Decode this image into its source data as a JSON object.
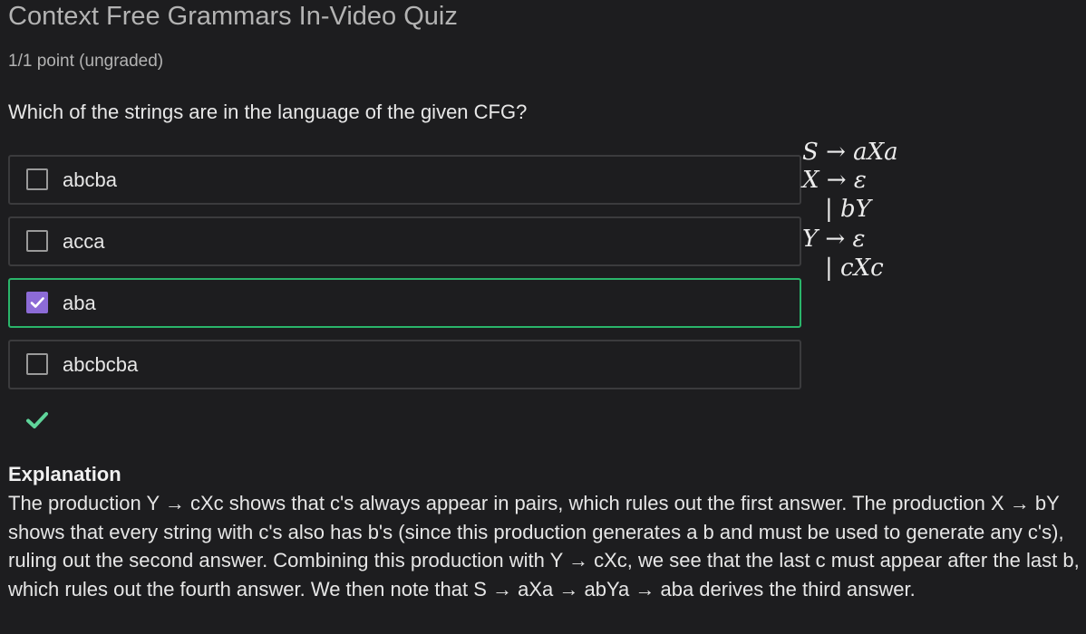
{
  "quiz": {
    "title": "Context Free Grammars In-Video Quiz",
    "score": "1/1 point (ungraded)",
    "question": "Which of the strings are in the language of the given CFG?"
  },
  "options": [
    {
      "label": "abcba",
      "checked": false,
      "selected": false
    },
    {
      "label": "acca",
      "checked": false,
      "selected": false
    },
    {
      "label": "aba",
      "checked": true,
      "selected": true
    },
    {
      "label": "abcbcba",
      "checked": false,
      "selected": false
    }
  ],
  "grammar": {
    "rules": [
      "S → aXa",
      "X → ε",
      "| bY",
      "Y → ε",
      "| cXc"
    ]
  },
  "result": {
    "icon": "checkmark-icon",
    "status": "correct"
  },
  "explanation": {
    "heading": "Explanation",
    "text": "The production Y → cXc shows that c's always appear in pairs, which rules out the first answer. The production X → bY shows that every string with c's also has b's (since this production generates a b and must be used to generate any c's), ruling out the second answer. Combining this production with Y → cXc, we see that the last c must appear after the last b, which rules out the fourth answer. We then note that S → aXa → abYa → aba derives the third answer."
  },
  "colors": {
    "background": "#1d1d1f",
    "selected_border": "#2ab56a",
    "checkbox_checked": "#8c6bd6",
    "correct_icon": "#5fd49a"
  }
}
